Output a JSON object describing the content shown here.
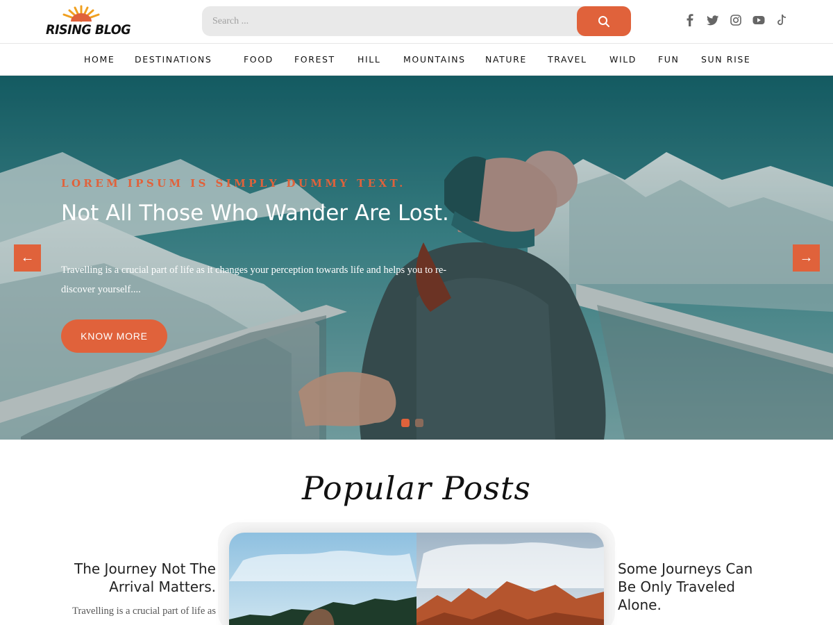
{
  "brand": {
    "name": "RISING BLOG"
  },
  "search": {
    "placeholder": "Search ..."
  },
  "social": [
    "facebook-icon",
    "twitter-icon",
    "instagram-icon",
    "youtube-icon",
    "tiktok-icon"
  ],
  "nav": {
    "items": [
      "HOME",
      "DESTINATIONS",
      "FOOD",
      "FOREST",
      "HILL",
      "MOUNTAINS",
      "NATURE",
      "TRAVEL",
      "WILD",
      "FUN",
      "SUN RISE"
    ]
  },
  "hero": {
    "eyebrow": "LOREM IPSUM IS SIMPLY DUMMY TEXT.",
    "title": "Not All Those Who Wander Are Lost.",
    "description": "Travelling is a crucial part of life as it changes your perception towards life and helps you to re-discover yourself....",
    "button": "KNOW MORE",
    "prev_arrow": "←",
    "next_arrow": "→",
    "slides": 2,
    "active_slide": 1
  },
  "popular": {
    "title": "Popular Posts",
    "left_post": {
      "title": "The Journey Not The Arrival Matters.",
      "excerpt": "Travelling is a crucial part of life as"
    },
    "right_post": {
      "title": "Some Journeys Can Be Only Traveled Alone."
    }
  },
  "colors": {
    "accent": "#e0623b",
    "text": "#222222",
    "nav_border": "#e6e6e6"
  }
}
